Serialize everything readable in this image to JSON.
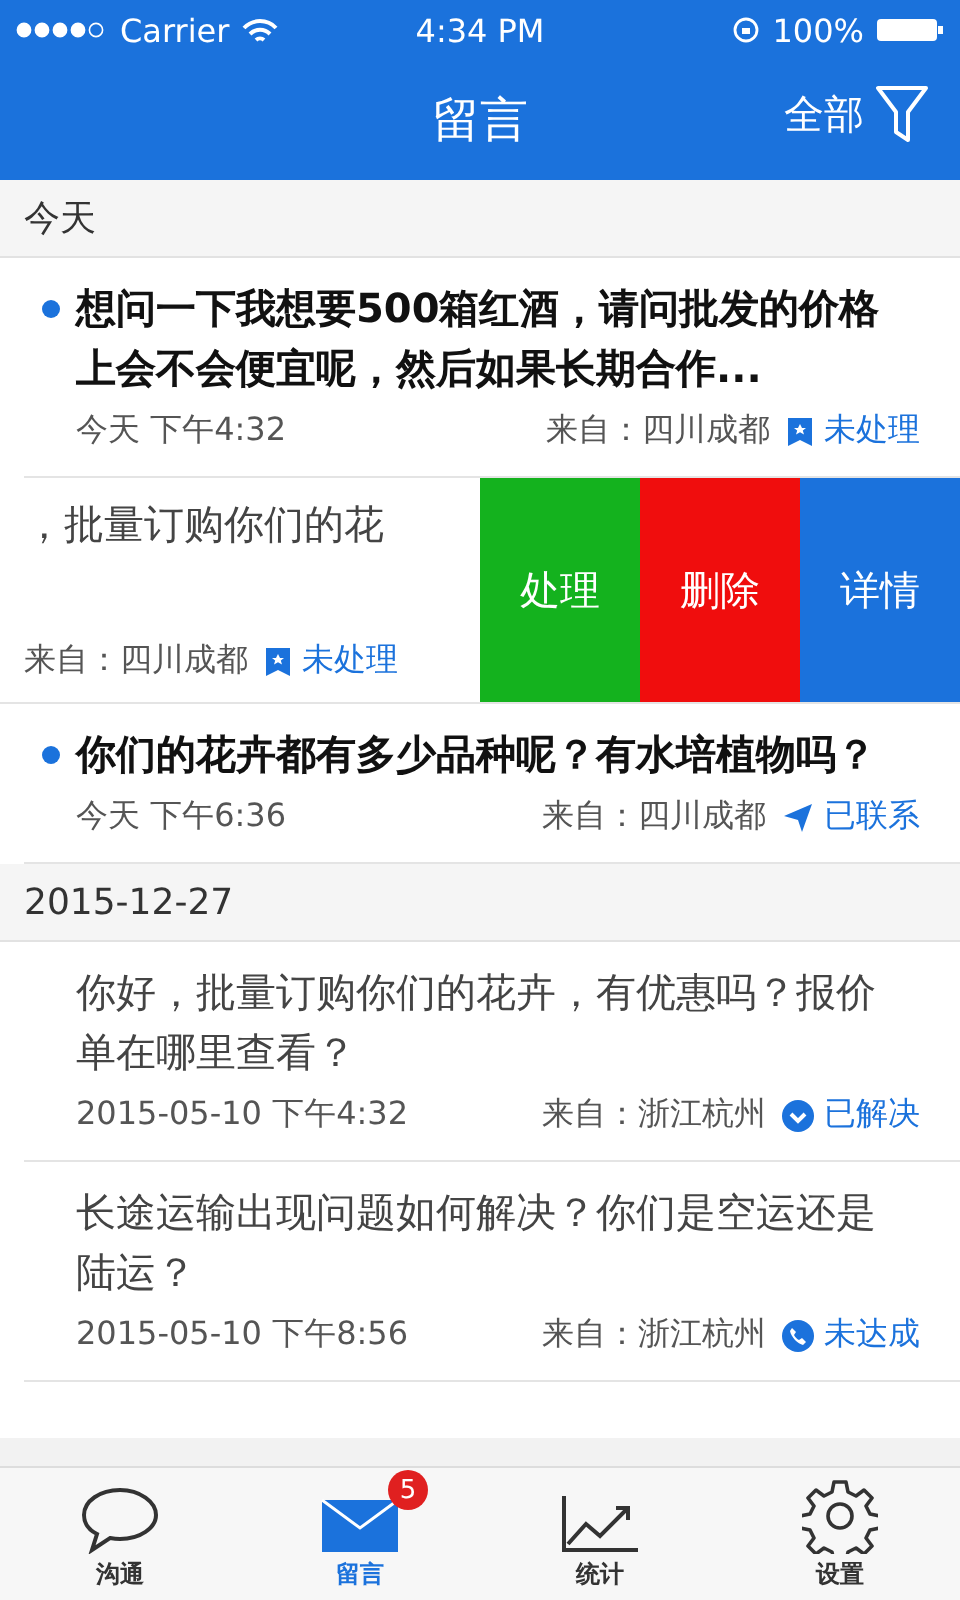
{
  "status_bar": {
    "carrier": "Carrier",
    "time": "4:34 PM",
    "battery": "100%"
  },
  "nav": {
    "title": "留言",
    "filter": "全部"
  },
  "sections": [
    {
      "date": "今天",
      "messages": [
        {
          "kind": "normal",
          "unread": true,
          "text": "想问一下我想要500箱红酒，请问批发的价格上会不会便宜呢，然后如果长期合作...",
          "time": "今天 下午4:32",
          "location": "来自：四川成都",
          "status": {
            "label": "未处理",
            "kind": "bookmark"
          }
        },
        {
          "kind": "swiped",
          "unread": false,
          "text": "，批量订购你们的花",
          "location": "来自：四川成都",
          "status": {
            "label": "未处理",
            "kind": "bookmark"
          }
        },
        {
          "kind": "normal",
          "unread": true,
          "text": "你们的花卉都有多少品种呢？有水培植物吗？",
          "time": "今天 下午6:36",
          "location": "来自：四川成都",
          "status": {
            "label": "已联系",
            "kind": "send"
          }
        }
      ]
    },
    {
      "date": "2015-12-27",
      "messages": [
        {
          "kind": "normal",
          "unread": false,
          "text": "你好，批量订购你们的花卉，有优惠吗？报价单在哪里查看？",
          "time": "2015-05-10 下午4:32",
          "location": "来自：浙江杭州",
          "status": {
            "label": "已解决",
            "kind": "check"
          }
        },
        {
          "kind": "normal",
          "unread": false,
          "text": "长途运输出现问题如何解决？你们是空运还是陆运？",
          "time": "2015-05-10 下午8:56",
          "location": "来自：浙江杭州",
          "status": {
            "label": "未达成",
            "kind": "phone"
          }
        }
      ]
    }
  ],
  "swipe_actions": [
    {
      "label": "处理",
      "color": "#14b21e"
    },
    {
      "label": "删除",
      "color": "#f00d0d"
    },
    {
      "label": "详情",
      "color": "#1b72dc"
    }
  ],
  "tabs": [
    {
      "label": "沟通",
      "kind": "chat",
      "selected": false
    },
    {
      "label": "留言",
      "kind": "mail",
      "selected": true,
      "badge": "5"
    },
    {
      "label": "统计",
      "kind": "chart",
      "selected": false
    },
    {
      "label": "设置",
      "kind": "gear",
      "selected": false
    }
  ]
}
